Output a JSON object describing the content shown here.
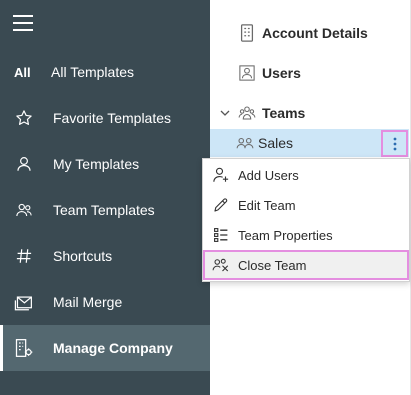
{
  "sidebar": {
    "items": [
      {
        "label": "All Templates",
        "icon": "all-text-icon",
        "icon_text": "All"
      },
      {
        "label": "Favorite Templates",
        "icon": "star-icon"
      },
      {
        "label": "My Templates",
        "icon": "person-icon"
      },
      {
        "label": "Team Templates",
        "icon": "people-icon"
      },
      {
        "label": "Shortcuts",
        "icon": "hash-icon"
      },
      {
        "label": "Mail Merge",
        "icon": "mail-merge-icon"
      },
      {
        "label": "Manage Company",
        "icon": "company-settings-icon",
        "active": true
      }
    ]
  },
  "tree": {
    "account_details": "Account Details",
    "users": "Users",
    "teams": "Teams",
    "sales": "Sales"
  },
  "context_menu": {
    "items": [
      {
        "label": "Add Users",
        "icon": "add-user-icon"
      },
      {
        "label": "Edit Team",
        "icon": "pencil-icon"
      },
      {
        "label": "Team Properties",
        "icon": "properties-list-icon"
      },
      {
        "label": "Close Team",
        "icon": "close-team-icon",
        "highlighted": true
      }
    ]
  },
  "colors": {
    "sidebar_bg": "#3a4a52",
    "sidebar_active": "#546870",
    "selected_row": "#cde6f7",
    "highlight_border": "#e48ee0"
  }
}
